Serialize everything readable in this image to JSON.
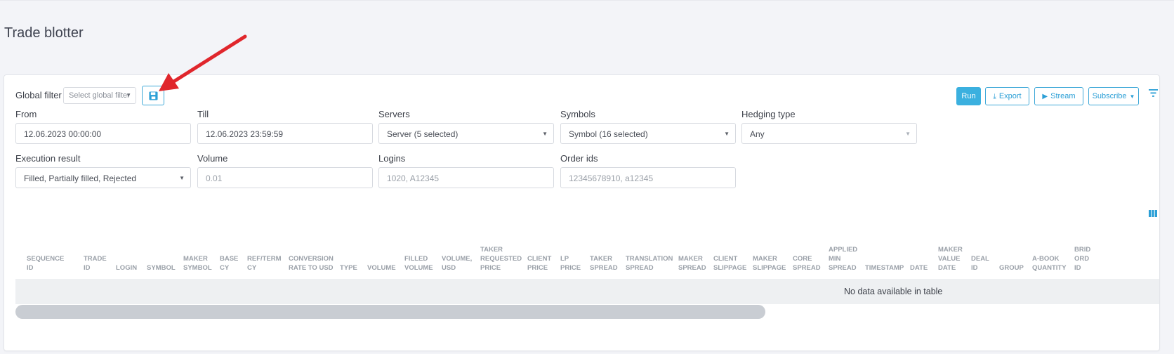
{
  "page": {
    "title": "Trade blotter"
  },
  "toolbar": {
    "global_filter_label": "Global filter",
    "global_filter_placeholder": "Select global filter",
    "run_label": "Run",
    "export_label": "Export",
    "stream_label": "Stream",
    "subscribe_label": "Subscribe"
  },
  "filters": {
    "from": {
      "label": "From",
      "value": "12.06.2023 00:00:00"
    },
    "till": {
      "label": "Till",
      "value": "12.06.2023 23:59:59"
    },
    "servers": {
      "label": "Servers",
      "value": "Server (5 selected)"
    },
    "symbols": {
      "label": "Symbols",
      "value": "Symbol (16 selected)"
    },
    "hedging": {
      "label": "Hedging type",
      "value": "Any"
    },
    "execution": {
      "label": "Execution result",
      "value": "Filled, Partially filled, Rejected"
    },
    "volume": {
      "label": "Volume",
      "placeholder": "0.01"
    },
    "logins": {
      "label": "Logins",
      "placeholder": "1020, A12345"
    },
    "order_ids": {
      "label": "Order ids",
      "placeholder": "12345678910, a12345"
    }
  },
  "table": {
    "columns": [
      "SEQUENCE\nID",
      "TRADE\nID",
      "LOGIN",
      "SYMBOL",
      "MAKER\nSYMBOL",
      "BASE\nCY",
      "REF/TERM\nCY",
      "CONVERSION\nRATE TO USD",
      "TYPE",
      "VOLUME",
      "FILLED\nVOLUME",
      "VOLUME,\nUSD",
      "TAKER\nREQUESTED\nPRICE",
      "CLIENT\nPRICE",
      "LP\nPRICE",
      "TAKER\nSPREAD",
      "TRANSLATION\nSPREAD",
      "MAKER\nSPREAD",
      "CLIENT\nSLIPPAGE",
      "MAKER\nSLIPPAGE",
      "CORE\nSPREAD",
      "APPLIED\nMIN\nSPREAD",
      "TIMESTAMP",
      "DATE",
      "MAKER\nVALUE\nDATE",
      "DEAL\nID",
      "GROUP",
      "A-BOOK\nQUANTITY",
      "BRID\nORD\nID"
    ],
    "empty_message": "No data available in table"
  },
  "colors": {
    "accent": "#3bb0df",
    "annotation_arrow": "#e0262c"
  },
  "icons": [
    "save-icon",
    "download-icon",
    "play-icon",
    "filter-icon",
    "columns-icon",
    "caret-down-icon"
  ]
}
